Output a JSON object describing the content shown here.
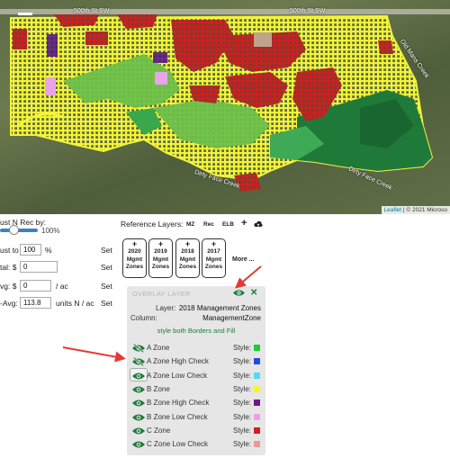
{
  "map": {
    "road_labels": [
      "500th St SW",
      "500th St SW"
    ],
    "creek_labels": [
      "Dirty Face Creek",
      "Dirty Face Creek",
      "Old Mans Creek"
    ],
    "attribution_link": "Leaflet",
    "attribution_text": " | © 2021 Microso"
  },
  "nrec": {
    "title": "ust N Rec by:",
    "slider_pct": "100%",
    "rows": [
      {
        "label": "ust to",
        "value": "100",
        "unit": "%",
        "set": "Set"
      },
      {
        "label": "tal: $",
        "value": "0",
        "unit": "",
        "set": "Set"
      },
      {
        "label": "vg: $",
        "value": "0",
        "unit": "/ ac",
        "set": "Set"
      },
      {
        "label": "-Avg:",
        "value": "113.8",
        "unit": "units N / ac",
        "set": "Set"
      }
    ]
  },
  "reference": {
    "title": "Reference Layers:",
    "tools": [
      "MZ",
      "Rec",
      "ELB",
      "+"
    ],
    "cloud_icon": "cloud-upload-icon",
    "years": [
      {
        "plus": "+",
        "year": "2020",
        "l1": "Mgmt",
        "l2": "Zones"
      },
      {
        "plus": "+",
        "year": "2019",
        "l1": "Mgmt",
        "l2": "Zones"
      },
      {
        "plus": "+",
        "year": "2018",
        "l1": "Mgmt",
        "l2": "Zones"
      },
      {
        "plus": "+",
        "year": "2017",
        "l1": "Mgmt",
        "l2": "Zones"
      }
    ],
    "more": "More ..."
  },
  "overlay": {
    "title": "OVERLAY LAYER",
    "layer_label": "Layer:",
    "layer_value": "2018 Management Zones",
    "column_label": "Column:",
    "column_value": "ManagementZone",
    "style_all": "style both Borders and Fill",
    "style_label": "Style:",
    "zones": [
      {
        "name": "A Zone",
        "color": "#22c93a",
        "hidden": true
      },
      {
        "name": "A Zone High Check",
        "color": "#1f4fe0",
        "hidden": true
      },
      {
        "name": "A Zone Low Check",
        "color": "#56d8f5",
        "hidden": false,
        "boxed": true
      },
      {
        "name": "B Zone",
        "color": "#f5f532",
        "hidden": false
      },
      {
        "name": "B Zone High Check",
        "color": "#6b1a8c",
        "hidden": false
      },
      {
        "name": "B Zone Low Check",
        "color": "#f09ee8",
        "hidden": false
      },
      {
        "name": "C Zone",
        "color": "#d81b1b",
        "hidden": false
      },
      {
        "name": "C Zone Low Check",
        "color": "#e89a9a",
        "hidden": false
      }
    ]
  },
  "colors": {
    "accent_green": "#1e7b3a",
    "arrow_red": "#e53935"
  }
}
